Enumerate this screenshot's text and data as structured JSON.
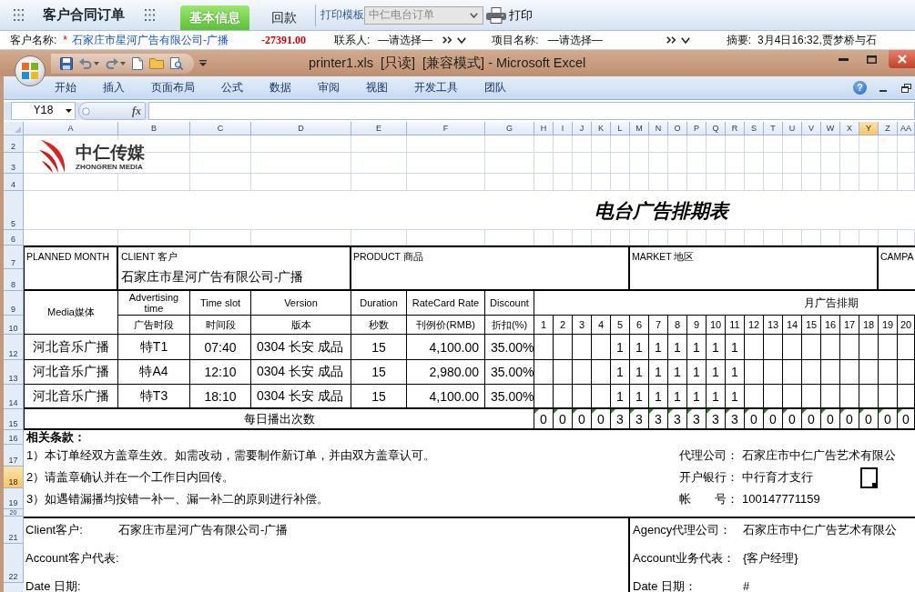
{
  "app_bar": {
    "title": "客户合同订单",
    "tabs": [
      {
        "label": "基本信息",
        "selected": true
      },
      {
        "label": "回款",
        "selected": false
      }
    ],
    "template": {
      "label": "打印模板",
      "value": "中仁电台订单",
      "disabled": true
    },
    "print_button": "打印"
  },
  "order_row": {
    "customer": {
      "label": "客户名称:",
      "required_mark": "*",
      "value": "石家庄市星河广告有限公司-广播"
    },
    "balance": "-27391.00",
    "contact": {
      "label": "联系人:",
      "value": "—请选择—"
    },
    "project": {
      "label": "项目名称:",
      "value": "—请选择—"
    },
    "summary": {
      "label": "摘要:",
      "value": "3月4日16:32,贾梦桥与石"
    }
  },
  "excel": {
    "title": "printer1.xls  [只读]  [兼容模式] - Microsoft Excel",
    "ribbon_tabs": [
      "开始",
      "插入",
      "页面布局",
      "公式",
      "数据",
      "审阅",
      "视图",
      "开发工具",
      "团队"
    ],
    "help_button": "?",
    "name_box": "Y18",
    "function_button": "fx"
  },
  "sheet": {
    "columns": [
      {
        "label": "A",
        "selected": false
      },
      {
        "label": "B",
        "selected": false
      },
      {
        "label": "C",
        "selected": false
      },
      {
        "label": "D",
        "selected": false
      },
      {
        "label": "E",
        "selected": false
      },
      {
        "label": "F",
        "selected": false
      },
      {
        "label": "G",
        "selected": false
      },
      {
        "label": "H",
        "selected": false
      },
      {
        "label": "I",
        "selected": false
      },
      {
        "label": "J",
        "selected": false
      },
      {
        "label": "K",
        "selected": false
      },
      {
        "label": "L",
        "selected": false
      },
      {
        "label": "M",
        "selected": false
      },
      {
        "label": "N",
        "selected": false
      },
      {
        "label": "O",
        "selected": false
      },
      {
        "label": "P",
        "selected": false
      },
      {
        "label": "Q",
        "selected": false
      },
      {
        "label": "R",
        "selected": false
      },
      {
        "label": "S",
        "selected": false
      },
      {
        "label": "T",
        "selected": false
      },
      {
        "label": "U",
        "selected": false
      },
      {
        "label": "V",
        "selected": false
      },
      {
        "label": "W",
        "selected": false
      },
      {
        "label": "X",
        "selected": false
      },
      {
        "label": "Y",
        "selected": true
      },
      {
        "label": "Z",
        "selected": false
      },
      {
        "label": "AA",
        "selected": false
      }
    ],
    "rows": [
      {
        "label": "2",
        "selected": false
      },
      {
        "label": "3",
        "selected": false
      },
      {
        "label": "4",
        "selected": false
      },
      {
        "label": "5",
        "selected": false
      },
      {
        "label": "6",
        "selected": false
      },
      {
        "label": "7",
        "selected": false
      },
      {
        "label": "8",
        "selected": false
      },
      {
        "label": "9",
        "selected": false
      },
      {
        "label": "10",
        "selected": false
      },
      {
        "label": "12",
        "selected": false
      },
      {
        "label": "13",
        "selected": false
      },
      {
        "label": "14",
        "selected": false
      },
      {
        "label": "15",
        "selected": false
      },
      {
        "label": "16",
        "selected": false
      },
      {
        "label": "17",
        "selected": false
      },
      {
        "label": "18",
        "selected": true
      },
      {
        "label": "19",
        "selected": false
      },
      {
        "label": "20",
        "selected": false
      },
      {
        "label": "21",
        "selected": false
      },
      {
        "label": "22",
        "selected": false
      }
    ],
    "logo": {
      "name": "中仁传媒",
      "tagline": "ZHONGREN MEDIA"
    },
    "title": "电台广告排期表",
    "info": {
      "planned_month": "PLANNED MONTH",
      "client_label": "CLIENT 客户",
      "client_value": "石家庄市星河广告有限公司-广播",
      "product_label": "PRODUCT 商品",
      "market_label": "MARKET 地区",
      "campaign_label": "CAMPA"
    },
    "headings": [
      {
        "title": "Media媒体"
      },
      {
        "title": "Advertising time",
        "subtitle": "广告时段"
      },
      {
        "title": "Time slot",
        "subtitle": "时间段"
      },
      {
        "title": "Version",
        "subtitle": "版本"
      },
      {
        "title": "Duration",
        "subtitle": "秒数"
      },
      {
        "title": "RateCard Rate",
        "subtitle": "刊例价(RMB)"
      },
      {
        "title": "Discount",
        "subtitle": "折扣(%)"
      }
    ],
    "schedule_heading": "月广告排期",
    "days": [
      "1",
      "2",
      "3",
      "4",
      "5",
      "6",
      "7",
      "8",
      "9",
      "10",
      "11",
      "12",
      "13",
      "14",
      "15",
      "16",
      "17",
      "18",
      "19",
      "20"
    ],
    "spots": [
      {
        "media": "河北音乐广播",
        "ad_time": "特T1",
        "time_slot": "07:40",
        "version": "0304 长安 成品",
        "duration": "15",
        "rate": "4,100.00",
        "discount": "35.00%",
        "days": [
          {
            "kind": "blank"
          },
          {
            "kind": "blank"
          },
          {
            "kind": "blank"
          },
          {
            "kind": "blank"
          },
          {
            "kind": "count",
            "count": "1"
          },
          {
            "kind": "count",
            "count": "1"
          },
          {
            "kind": "count",
            "count": "1"
          },
          {
            "kind": "count",
            "count": "1"
          },
          {
            "kind": "count",
            "count": "1"
          },
          {
            "kind": "count",
            "count": "1"
          },
          {
            "kind": "count",
            "count": "1"
          },
          {
            "kind": "blank"
          },
          {
            "kind": "blank"
          },
          {
            "kind": "blank"
          },
          {
            "kind": "blank"
          },
          {
            "kind": "blank"
          },
          {
            "kind": "blank"
          },
          {
            "kind": "blank"
          },
          {
            "kind": "blank"
          },
          {
            "kind": "blank"
          }
        ]
      },
      {
        "media": "河北音乐广播",
        "ad_time": "特A4",
        "time_slot": "12:10",
        "version": "0304 长安 成品",
        "duration": "15",
        "rate": "2,980.00",
        "discount": "35.00%",
        "days": [
          {
            "kind": "blank"
          },
          {
            "kind": "blank"
          },
          {
            "kind": "blank"
          },
          {
            "kind": "blank"
          },
          {
            "kind": "count",
            "count": "1"
          },
          {
            "kind": "count",
            "count": "1"
          },
          {
            "kind": "count",
            "count": "1"
          },
          {
            "kind": "count",
            "count": "1"
          },
          {
            "kind": "count",
            "count": "1"
          },
          {
            "kind": "count",
            "count": "1"
          },
          {
            "kind": "count",
            "count": "1"
          },
          {
            "kind": "blank"
          },
          {
            "kind": "blank"
          },
          {
            "kind": "blank"
          },
          {
            "kind": "blank"
          },
          {
            "kind": "blank"
          },
          {
            "kind": "blank"
          },
          {
            "kind": "blank"
          },
          {
            "kind": "blank"
          },
          {
            "kind": "blank"
          }
        ]
      },
      {
        "media": "河北音乐广播",
        "ad_time": "特T3",
        "time_slot": "18:10",
        "version": "0304 长安 成品",
        "duration": "15",
        "rate": "4,100.00",
        "discount": "35.00%",
        "days": [
          {
            "kind": "blank"
          },
          {
            "kind": "blank"
          },
          {
            "kind": "blank"
          },
          {
            "kind": "blank"
          },
          {
            "kind": "count",
            "count": "1"
          },
          {
            "kind": "count",
            "count": "1"
          },
          {
            "kind": "count",
            "count": "1"
          },
          {
            "kind": "count",
            "count": "1"
          },
          {
            "kind": "count",
            "count": "1"
          },
          {
            "kind": "count",
            "count": "1"
          },
          {
            "kind": "count",
            "count": "1"
          },
          {
            "kind": "blank"
          },
          {
            "kind": "blank"
          },
          {
            "kind": "blank"
          },
          {
            "kind": "blank"
          },
          {
            "kind": "blank"
          },
          {
            "kind": "blank"
          },
          {
            "kind": "blank"
          },
          {
            "kind": "blank"
          },
          {
            "kind": "blank"
          }
        ]
      }
    ],
    "daily_total": {
      "label": "每日播出次数",
      "counts": [
        {
          "value": "0",
          "flagged": true
        },
        {
          "value": "0",
          "flagged": true
        },
        {
          "value": "0",
          "flagged": true
        },
        {
          "value": "0",
          "flagged": true
        },
        {
          "value": "3",
          "flagged": true
        },
        {
          "value": "3",
          "flagged": true
        },
        {
          "value": "3",
          "flagged": true
        },
        {
          "value": "3",
          "flagged": true
        },
        {
          "value": "3",
          "flagged": true
        },
        {
          "value": "3",
          "flagged": true
        },
        {
          "value": "3",
          "flagged": true
        },
        {
          "value": "0",
          "flagged": true
        },
        {
          "value": "0",
          "flagged": true
        },
        {
          "value": "0",
          "flagged": true
        },
        {
          "value": "0",
          "flagged": true
        },
        {
          "value": "0",
          "flagged": true
        },
        {
          "value": "0",
          "flagged": true
        },
        {
          "value": "0",
          "flagged": true
        },
        {
          "value": "0",
          "flagged": true
        },
        {
          "value": "0",
          "flagged": true
        }
      ]
    },
    "terms": {
      "title": "相关条款：",
      "items": [
        "1）本订单经双方盖章生效。如需改动，需要制作新订单，并由双方盖章认可。",
        "2）请盖章确认并在一个工作日内回传。",
        "3）如遇错漏播均按错一补一、漏一补二的原则进行补偿。"
      ]
    },
    "bank": [
      {
        "label": "代理公司：",
        "value": "石家庄市中仁广告艺术有限公"
      },
      {
        "label": "开户银行：",
        "value": "中行育才支行"
      },
      {
        "label": "帐　　号：",
        "value": "100147771159"
      }
    ],
    "signatures": {
      "client": [
        {
          "label": "Client客户:",
          "value": "石家庄市星河广告有限公司-广播"
        },
        {
          "label": "Account客户代表:"
        },
        {
          "label": "Date 日期:"
        }
      ],
      "agency": [
        {
          "label": "Agency代理公司：",
          "value": "石家庄市中仁广告艺术有限公"
        },
        {
          "label": "Account业务代表：",
          "value": "{客户经理}"
        },
        {
          "label": "Date 日期：",
          "value": "#"
        }
      ]
    }
  }
}
